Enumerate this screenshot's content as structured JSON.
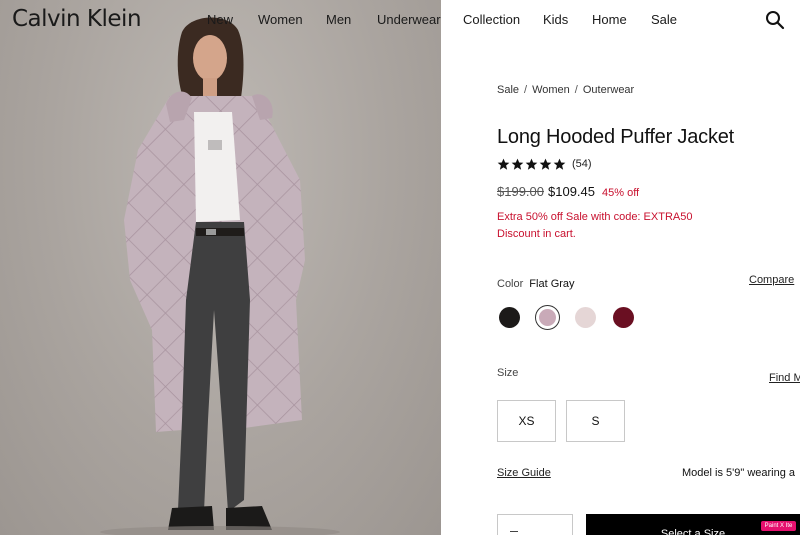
{
  "header": {
    "logo": "Calvin Klein",
    "nav": [
      "New",
      "Women",
      "Men",
      "Underwear",
      "Collection",
      "Kids",
      "Home",
      "Sale"
    ],
    "search_icon": "search-icon"
  },
  "breadcrumb": [
    "Sale",
    "Women",
    "Outerwear"
  ],
  "product": {
    "title": "Long Hooded Puffer Jacket",
    "rating": 5,
    "review_count": "(54)",
    "price_original": "$199.00",
    "price_sale": "$109.45",
    "discount": "45% off",
    "promo_line1": "Extra 50% off Sale with code: EXTRA50",
    "promo_line2": "Discount in cart."
  },
  "color": {
    "label": "Color",
    "selected": "Flat Gray",
    "compare_link": "Compare",
    "swatches": [
      {
        "name": "black",
        "color": "#1c1a19"
      },
      {
        "name": "flat-gray",
        "color": "#c9aab8",
        "selected": true
      },
      {
        "name": "light-pink",
        "color": "#e5d6d6"
      },
      {
        "name": "burgundy",
        "color": "#6a0f22"
      }
    ]
  },
  "size": {
    "label": "Size",
    "find_link": "Find M",
    "options": [
      "XS",
      "S"
    ],
    "guide_link": "Size Guide",
    "model_info": "Model is 5'9\" wearing a"
  },
  "cart": {
    "add_label": "Select a Size"
  },
  "badge": "Paint X Ite",
  "colors": {
    "accent_red": "#c8102e",
    "hero_bg": "#aaa49f"
  }
}
